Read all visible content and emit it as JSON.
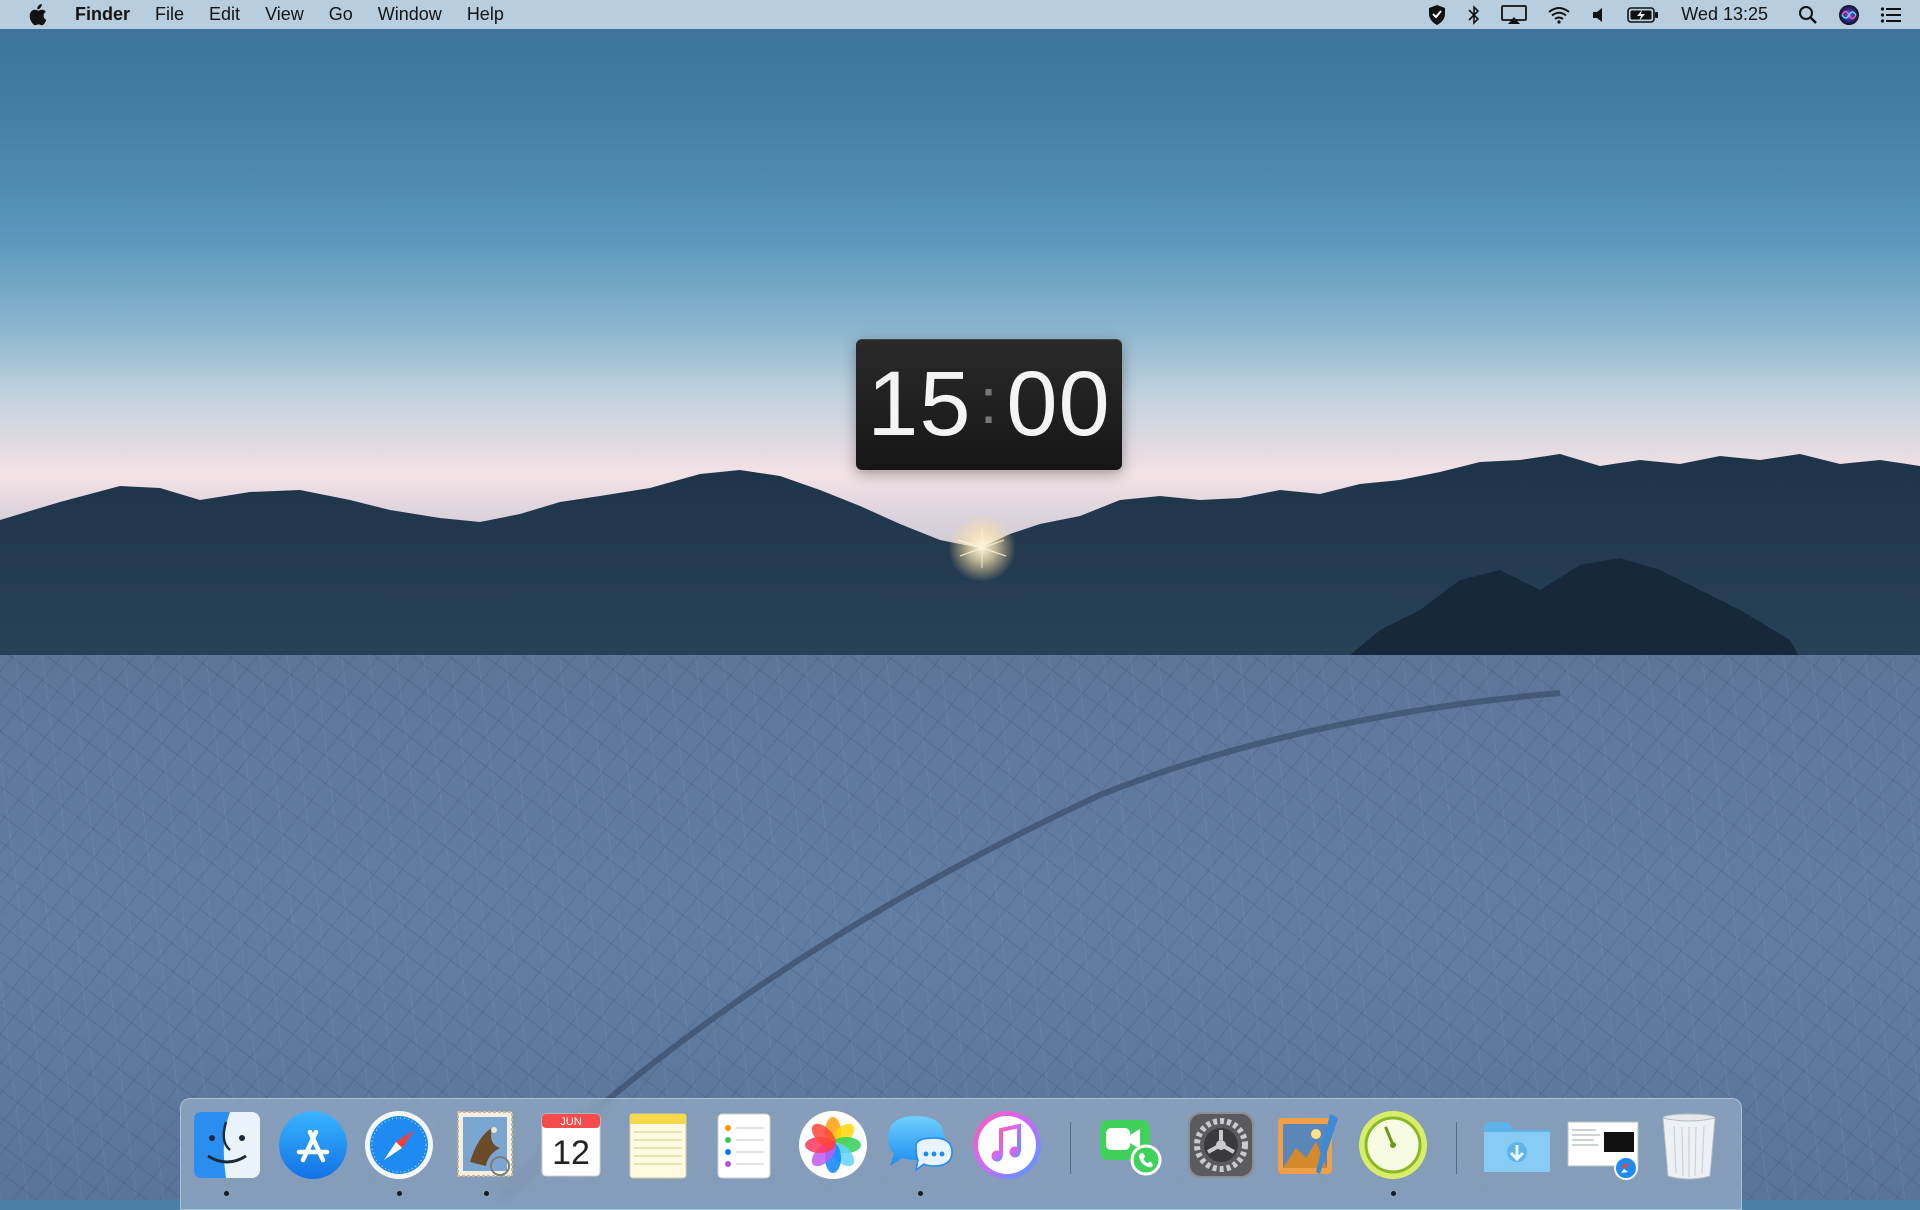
{
  "menubar": {
    "app_name": "Finder",
    "menus": [
      "File",
      "Edit",
      "View",
      "Go",
      "Window",
      "Help"
    ],
    "clock": "Wed 13:25",
    "status_icons": [
      "vpn-shield-icon",
      "bluetooth-icon",
      "airplay-icon",
      "wifi-icon",
      "volume-icon",
      "battery-charging-icon",
      "spotlight-search-icon",
      "siri-icon",
      "notification-center-icon"
    ]
  },
  "timer": {
    "hours": "15",
    "separator": ":",
    "minutes": "00"
  },
  "dock": {
    "apps": [
      {
        "name": "Finder",
        "icon": "finder-icon",
        "running": true
      },
      {
        "name": "App Store",
        "icon": "app-store-icon",
        "running": false
      },
      {
        "name": "Safari",
        "icon": "safari-icon",
        "running": true
      },
      {
        "name": "Mail",
        "icon": "mail-icon",
        "running": true
      },
      {
        "name": "Calendar",
        "icon": "calendar-icon",
        "running": false
      },
      {
        "name": "Notes",
        "icon": "notes-icon",
        "running": false
      },
      {
        "name": "Reminders",
        "icon": "reminders-icon",
        "running": false
      },
      {
        "name": "Photos",
        "icon": "photos-icon",
        "running": false
      },
      {
        "name": "Messages",
        "icon": "messages-icon",
        "running": true
      },
      {
        "name": "iTunes",
        "icon": "itunes-icon",
        "running": false
      },
      {
        "name": "FaceTime",
        "icon": "facetime-icon",
        "running": false
      },
      {
        "name": "System Preferences",
        "icon": "system-preferences-icon",
        "running": false
      },
      {
        "name": "Preview",
        "icon": "preview-icon",
        "running": false
      },
      {
        "name": "Timer",
        "icon": "timer-app-icon",
        "running": true
      },
      {
        "name": "Downloads",
        "icon": "downloads-folder-icon",
        "running": false
      },
      {
        "name": "Safari Document",
        "icon": "safari-document-icon",
        "running": false
      },
      {
        "name": "Trash",
        "icon": "trash-icon",
        "running": false
      }
    ],
    "calendar_month": "JUN",
    "calendar_day": "12"
  },
  "colors": {
    "menubar_bg": "#cddce9",
    "timer_bg": "#1c1c1c",
    "timer_text": "#f4f4f4",
    "dock_bg": "#aabed6"
  }
}
